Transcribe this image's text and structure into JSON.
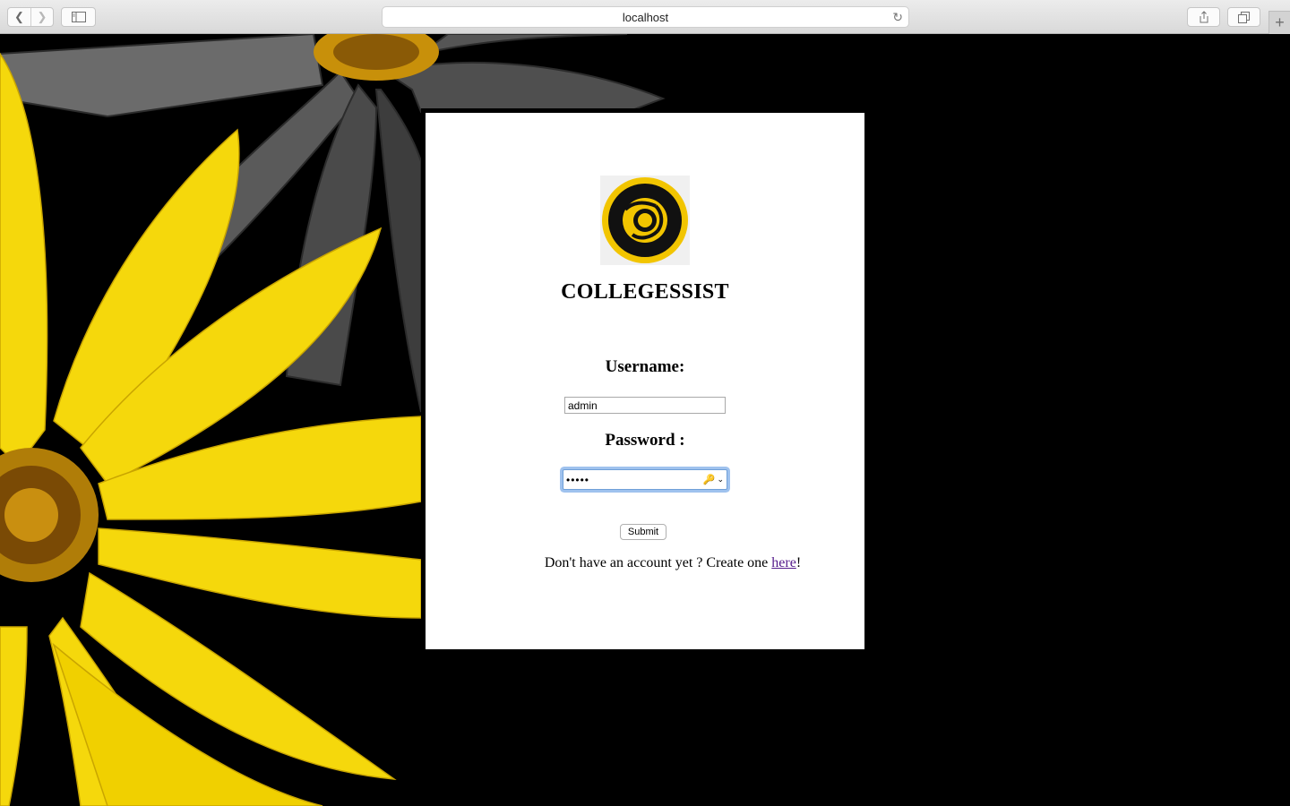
{
  "browser": {
    "url": "localhost",
    "icons": {
      "back": "chevron-left-icon",
      "forward": "chevron-right-icon",
      "sidebar": "sidebar-icon",
      "reload": "reload-icon",
      "share": "share-icon",
      "tabs": "tabs-overview-icon",
      "new_tab": "plus-icon"
    }
  },
  "login": {
    "brand": "COLLEGESSIST",
    "username_label": "Username:",
    "username_value": "admin",
    "password_label": "Password :",
    "password_value": "•••••",
    "submit_label": "Submit",
    "signup_prefix": "Don't have an account yet ? Create one ",
    "signup_link": "here",
    "signup_suffix": "!"
  },
  "colors": {
    "page_background": "#000000",
    "card_background": "#ffffff",
    "logo_yellow": "#f2c500",
    "link_visited": "#551a8b",
    "focus_ring": "#9fc2ee"
  }
}
